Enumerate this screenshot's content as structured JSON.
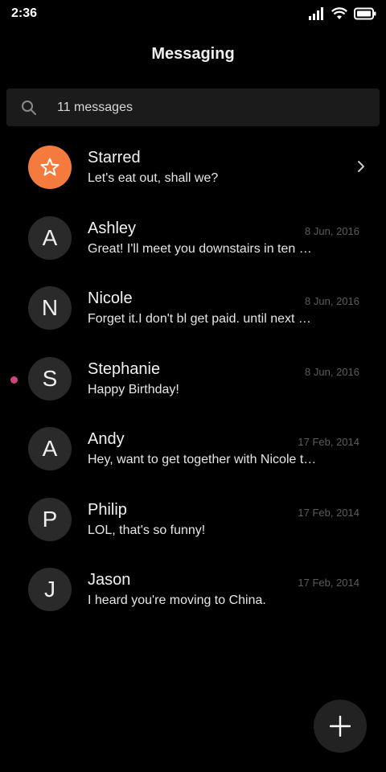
{
  "status_bar": {
    "time": "2:36",
    "icons": [
      "signal-icon",
      "wifi-icon",
      "battery-icon"
    ]
  },
  "header": {
    "title": "Messaging"
  },
  "search": {
    "placeholder": "11 messages",
    "icon": "search-icon"
  },
  "starred": {
    "name": "Starred",
    "preview": "Let's eat out, shall we?",
    "icon": "star-icon",
    "avatar_color": "#f47a3d"
  },
  "conversations": [
    {
      "initial": "A",
      "name": "Ashley",
      "date": "8 Jun, 2016",
      "preview": "Great! I'll meet you downstairs in ten minutes.",
      "unread": false
    },
    {
      "initial": "N",
      "name": "Nicole",
      "date": "8 Jun, 2016",
      "preview": "Forget it.I don't bl get paid. until next Friday.",
      "unread": false
    },
    {
      "initial": "S",
      "name": "Stephanie",
      "date": "8 Jun, 2016",
      "preview": "Happy Birthday!",
      "unread": true
    },
    {
      "initial": "A",
      "name": "Andy",
      "date": "17 Feb, 2014",
      "preview": "Hey, want to get together with Nicole tonight?",
      "unread": false
    },
    {
      "initial": "P",
      "name": "Philip",
      "date": "17 Feb, 2014",
      "preview": "LOL, that's so funny!",
      "unread": false
    },
    {
      "initial": "J",
      "name": "Jason",
      "date": "17 Feb, 2014",
      "preview": "I heard you're moving to China.",
      "unread": false
    }
  ],
  "colors": {
    "background": "#000000",
    "accent_starred": "#f47a3d",
    "unread_dot": "#d0427c",
    "avatar_bg": "#2a2a2a"
  },
  "fab": {
    "icon": "plus-icon"
  }
}
